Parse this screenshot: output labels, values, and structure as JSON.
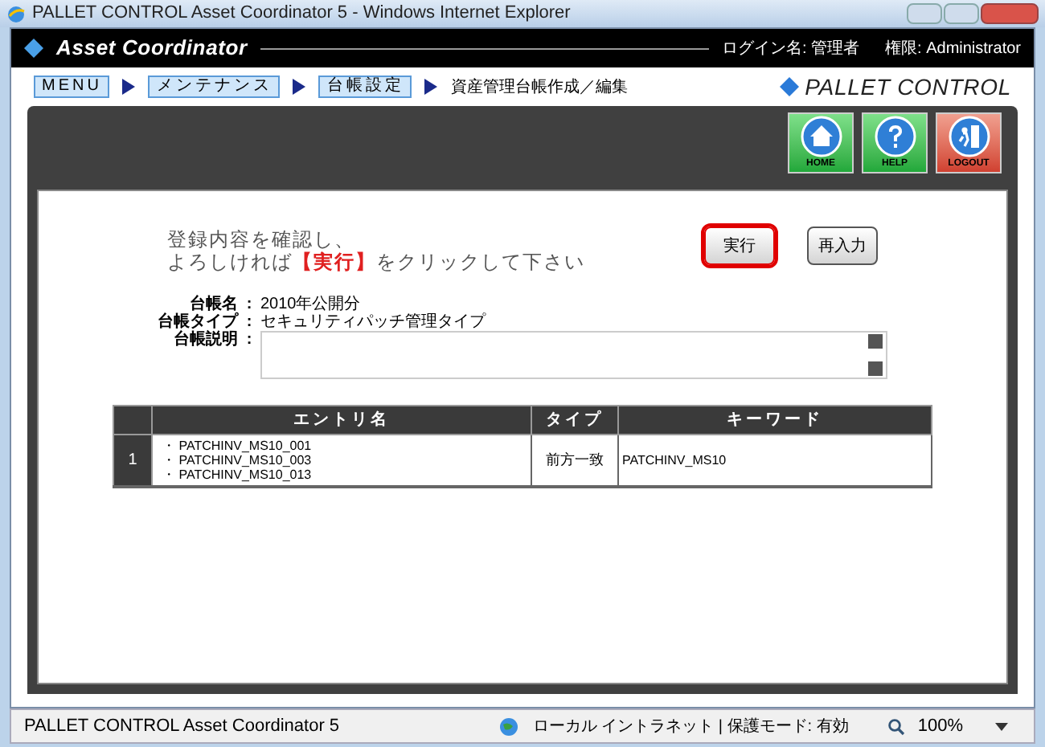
{
  "window": {
    "title": "PALLET CONTROL Asset Coordinator 5 - Windows Internet Explorer"
  },
  "header": {
    "app_name": "Asset Coordinator",
    "login": "ログイン名: 管理者",
    "role": "権限: Administrator"
  },
  "breadcrumb": [
    {
      "label": "MENU",
      "kind": "link"
    },
    {
      "label": "メンテナンス",
      "kind": "link"
    },
    {
      "label": "台帳設定",
      "kind": "link"
    },
    {
      "label": "資産管理台帳作成／編集",
      "kind": "current"
    }
  ],
  "brand": "PALLET CONTROL",
  "toolbar": [
    {
      "label": "HOME",
      "kind": "home"
    },
    {
      "label": "HELP",
      "kind": "help"
    },
    {
      "label": "LOGOUT",
      "kind": "logout"
    }
  ],
  "message": {
    "line1": "登録内容を確認し、",
    "line2_before": "よろしければ",
    "line2_em": "【実行】",
    "line2_after": "をクリックして下さい"
  },
  "buttons": [
    {
      "label": "実行",
      "focused": true
    },
    {
      "label": "再入力",
      "focused": false
    }
  ],
  "fields": [
    {
      "label": "台帳名",
      "separator": ":",
      "value": "2010年公開分",
      "kind": "text"
    },
    {
      "label": "台帳タイプ",
      "separator": ":",
      "value": "セキュリティパッチ管理タイプ",
      "kind": "text"
    },
    {
      "label": "台帳説明",
      "separator": ":",
      "kind": "textarea"
    }
  ],
  "table": {
    "columns": [
      "エントリ名",
      "タイプ",
      "キーワード"
    ],
    "rows": [
      {
        "number": "1",
        "entries": [
          "・ PATCHINV_MS10_001",
          "・ PATCHINV_MS10_003",
          "・ PATCHINV_MS10_013"
        ],
        "type": "前方一致",
        "keyword": "PATCHINV_MS10"
      }
    ]
  },
  "status_bar": {
    "text": "PALLET CONTROL Asset Coordinator 5",
    "zone": "ローカル イントラネット | 保護モード: 有効",
    "zoom": "100%"
  }
}
